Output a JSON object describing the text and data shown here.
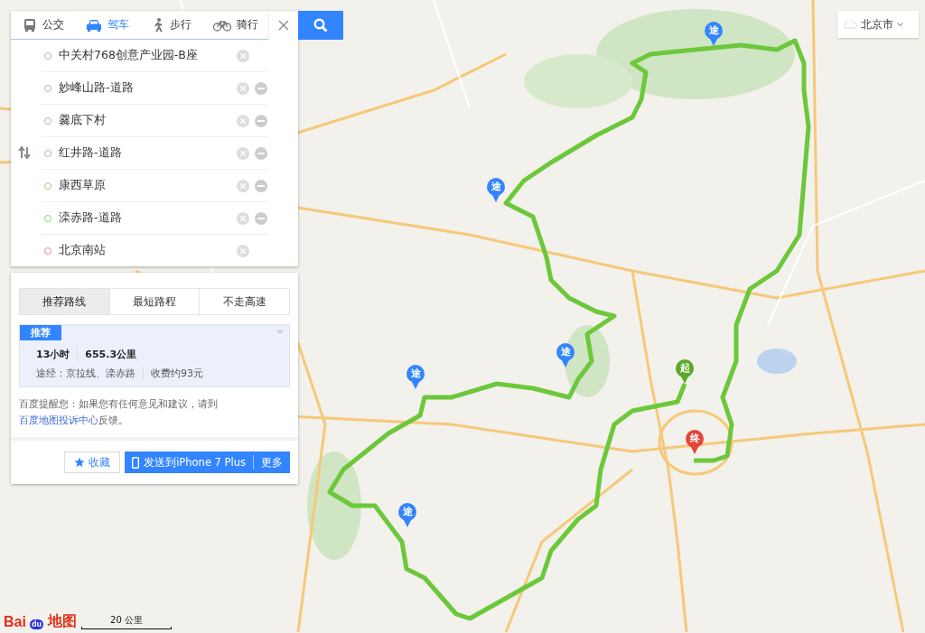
{
  "mode_tabs": [
    {
      "label": "公交",
      "kind": "bus",
      "selected": false
    },
    {
      "label": "驾车",
      "kind": "car",
      "selected": true
    },
    {
      "label": "步行",
      "kind": "walk",
      "selected": false
    },
    {
      "label": "骑行",
      "kind": "bike",
      "selected": false
    }
  ],
  "waypoints": [
    {
      "name": "中关村768创意产业园-B座",
      "kind": "start",
      "removable": false,
      "swap": false
    },
    {
      "name": "妙峰山路-道路",
      "kind": "via",
      "removable": true,
      "swap": false
    },
    {
      "name": "爨底下村",
      "kind": "via",
      "removable": true,
      "swap": false
    },
    {
      "name": "红井路-道路",
      "kind": "via",
      "removable": true,
      "swap": true
    },
    {
      "name": "康西草原",
      "kind": "via",
      "removable": true,
      "swap": false
    },
    {
      "name": "滦赤路-道路",
      "kind": "via",
      "removable": true,
      "swap": false
    },
    {
      "name": "北京南站",
      "kind": "end",
      "removable": false,
      "swap": false
    }
  ],
  "route_tabs": [
    {
      "label": "推荐路线",
      "selected": true
    },
    {
      "label": "最短路程",
      "selected": false
    },
    {
      "label": "不走高速",
      "selected": false
    }
  ],
  "route": {
    "badge": "推荐",
    "duration": "13小时",
    "distance": "655.3公里",
    "via": "途经：京拉线、滦赤路",
    "toll": "收费约93元"
  },
  "notice": {
    "text": "百度提醒您：如果您有任何意见和建议，请到",
    "link": "百度地图投诉中心",
    "tail": "反馈。"
  },
  "actions": {
    "favorite": "收藏",
    "send": "发送到iPhone 7 Plus",
    "more": "更多"
  },
  "city": "北京市",
  "pins": [
    {
      "label": "途",
      "kind": "via"
    },
    {
      "label": "途",
      "kind": "via"
    },
    {
      "label": "途",
      "kind": "via"
    },
    {
      "label": "起",
      "kind": "start"
    },
    {
      "label": "途",
      "kind": "via"
    },
    {
      "label": "终",
      "kind": "end"
    },
    {
      "label": "途",
      "kind": "via"
    }
  ],
  "logo": {
    "left": "Bai",
    "paw": "du",
    "right": "地图"
  },
  "scale": "20 公里"
}
